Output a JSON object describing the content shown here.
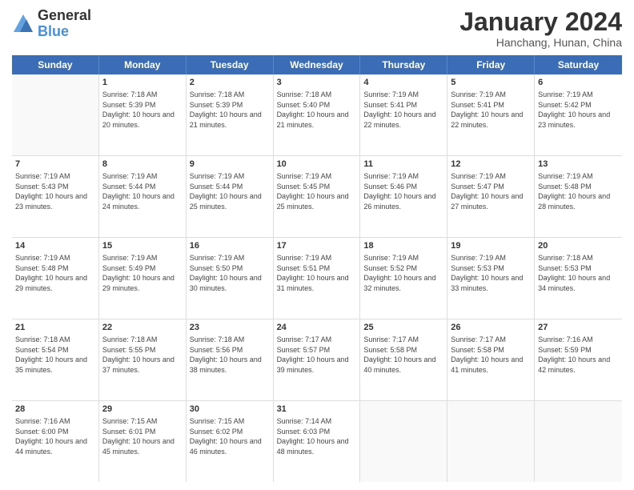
{
  "header": {
    "logo_line1": "General",
    "logo_line2": "Blue",
    "title": "January 2024",
    "subtitle": "Hanchang, Hunan, China"
  },
  "days": [
    "Sunday",
    "Monday",
    "Tuesday",
    "Wednesday",
    "Thursday",
    "Friday",
    "Saturday"
  ],
  "weeks": [
    [
      {
        "num": "",
        "empty": true
      },
      {
        "num": "1",
        "sunrise": "7:18 AM",
        "sunset": "5:39 PM",
        "daylight": "10 hours and 20 minutes."
      },
      {
        "num": "2",
        "sunrise": "7:18 AM",
        "sunset": "5:39 PM",
        "daylight": "10 hours and 21 minutes."
      },
      {
        "num": "3",
        "sunrise": "7:18 AM",
        "sunset": "5:40 PM",
        "daylight": "10 hours and 21 minutes."
      },
      {
        "num": "4",
        "sunrise": "7:19 AM",
        "sunset": "5:41 PM",
        "daylight": "10 hours and 22 minutes."
      },
      {
        "num": "5",
        "sunrise": "7:19 AM",
        "sunset": "5:41 PM",
        "daylight": "10 hours and 22 minutes."
      },
      {
        "num": "6",
        "sunrise": "7:19 AM",
        "sunset": "5:42 PM",
        "daylight": "10 hours and 23 minutes."
      }
    ],
    [
      {
        "num": "7",
        "sunrise": "7:19 AM",
        "sunset": "5:43 PM",
        "daylight": "10 hours and 23 minutes."
      },
      {
        "num": "8",
        "sunrise": "7:19 AM",
        "sunset": "5:44 PM",
        "daylight": "10 hours and 24 minutes."
      },
      {
        "num": "9",
        "sunrise": "7:19 AM",
        "sunset": "5:44 PM",
        "daylight": "10 hours and 25 minutes."
      },
      {
        "num": "10",
        "sunrise": "7:19 AM",
        "sunset": "5:45 PM",
        "daylight": "10 hours and 25 minutes."
      },
      {
        "num": "11",
        "sunrise": "7:19 AM",
        "sunset": "5:46 PM",
        "daylight": "10 hours and 26 minutes."
      },
      {
        "num": "12",
        "sunrise": "7:19 AM",
        "sunset": "5:47 PM",
        "daylight": "10 hours and 27 minutes."
      },
      {
        "num": "13",
        "sunrise": "7:19 AM",
        "sunset": "5:48 PM",
        "daylight": "10 hours and 28 minutes."
      }
    ],
    [
      {
        "num": "14",
        "sunrise": "7:19 AM",
        "sunset": "5:48 PM",
        "daylight": "10 hours and 29 minutes."
      },
      {
        "num": "15",
        "sunrise": "7:19 AM",
        "sunset": "5:49 PM",
        "daylight": "10 hours and 29 minutes."
      },
      {
        "num": "16",
        "sunrise": "7:19 AM",
        "sunset": "5:50 PM",
        "daylight": "10 hours and 30 minutes."
      },
      {
        "num": "17",
        "sunrise": "7:19 AM",
        "sunset": "5:51 PM",
        "daylight": "10 hours and 31 minutes."
      },
      {
        "num": "18",
        "sunrise": "7:19 AM",
        "sunset": "5:52 PM",
        "daylight": "10 hours and 32 minutes."
      },
      {
        "num": "19",
        "sunrise": "7:19 AM",
        "sunset": "5:53 PM",
        "daylight": "10 hours and 33 minutes."
      },
      {
        "num": "20",
        "sunrise": "7:18 AM",
        "sunset": "5:53 PM",
        "daylight": "10 hours and 34 minutes."
      }
    ],
    [
      {
        "num": "21",
        "sunrise": "7:18 AM",
        "sunset": "5:54 PM",
        "daylight": "10 hours and 35 minutes."
      },
      {
        "num": "22",
        "sunrise": "7:18 AM",
        "sunset": "5:55 PM",
        "daylight": "10 hours and 37 minutes."
      },
      {
        "num": "23",
        "sunrise": "7:18 AM",
        "sunset": "5:56 PM",
        "daylight": "10 hours and 38 minutes."
      },
      {
        "num": "24",
        "sunrise": "7:17 AM",
        "sunset": "5:57 PM",
        "daylight": "10 hours and 39 minutes."
      },
      {
        "num": "25",
        "sunrise": "7:17 AM",
        "sunset": "5:58 PM",
        "daylight": "10 hours and 40 minutes."
      },
      {
        "num": "26",
        "sunrise": "7:17 AM",
        "sunset": "5:58 PM",
        "daylight": "10 hours and 41 minutes."
      },
      {
        "num": "27",
        "sunrise": "7:16 AM",
        "sunset": "5:59 PM",
        "daylight": "10 hours and 42 minutes."
      }
    ],
    [
      {
        "num": "28",
        "sunrise": "7:16 AM",
        "sunset": "6:00 PM",
        "daylight": "10 hours and 44 minutes."
      },
      {
        "num": "29",
        "sunrise": "7:15 AM",
        "sunset": "6:01 PM",
        "daylight": "10 hours and 45 minutes."
      },
      {
        "num": "30",
        "sunrise": "7:15 AM",
        "sunset": "6:02 PM",
        "daylight": "10 hours and 46 minutes."
      },
      {
        "num": "31",
        "sunrise": "7:14 AM",
        "sunset": "6:03 PM",
        "daylight": "10 hours and 48 minutes."
      },
      {
        "num": "",
        "empty": true
      },
      {
        "num": "",
        "empty": true
      },
      {
        "num": "",
        "empty": true
      }
    ]
  ]
}
